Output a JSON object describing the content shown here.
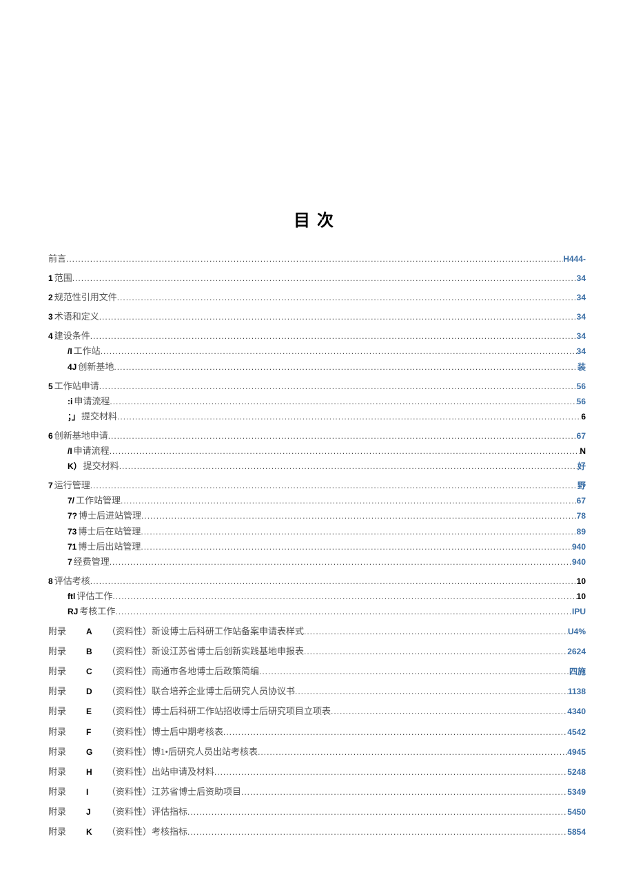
{
  "title": "目次",
  "entries": [
    {
      "level": 0,
      "num": "",
      "label": "前言",
      "page": "H444-",
      "pageClass": "link",
      "numBold": false
    },
    {
      "level": 0,
      "num": "1",
      "label": "范围",
      "page": "34",
      "pageClass": "link",
      "gap": true
    },
    {
      "level": 0,
      "num": "2",
      "label": "规范性引用文件",
      "page": "34",
      "pageClass": "link",
      "gap": true
    },
    {
      "level": 0,
      "num": "3",
      "label": "术语和定义",
      "page": "34",
      "pageClass": "link",
      "gap": true
    },
    {
      "level": 0,
      "num": "4",
      "label": "建设条件",
      "page": "34",
      "pageClass": "link",
      "gap": true
    },
    {
      "level": 1,
      "num": "/I",
      "label": "工作站",
      "page": "34",
      "pageClass": "link"
    },
    {
      "level": 1,
      "num": "4J",
      "label": "创新基地",
      "page": "装",
      "pageClass": "link"
    },
    {
      "level": 0,
      "num": "5",
      "label": "工作站申请",
      "page": "56",
      "pageClass": "link",
      "gap": true
    },
    {
      "level": 1,
      "num": ":i",
      "label": "申请流程",
      "page": "56",
      "pageClass": "link"
    },
    {
      "level": 1,
      "num": "；」",
      "label": "提交材料",
      "page": "6",
      "pageClass": "black"
    },
    {
      "level": 0,
      "num": "6",
      "label": "创新基地申请",
      "page": "67",
      "pageClass": "link",
      "gap": true
    },
    {
      "level": 1,
      "num": "/I",
      "label": "申请流程",
      "page": "N",
      "pageClass": "black"
    },
    {
      "level": 1,
      "num": "K）",
      "label": "提交材料",
      "page": "好",
      "pageClass": "link"
    },
    {
      "level": 0,
      "num": "7",
      "label": "运行管理",
      "page": "野",
      "pageClass": "link",
      "gap": true
    },
    {
      "level": 1,
      "num": "7/",
      "label": "工作站管理",
      "page": "67",
      "pageClass": "link"
    },
    {
      "level": 1,
      "num": "7?",
      "label": "博士后进站管理",
      "page": "78",
      "pageClass": "link"
    },
    {
      "level": 1,
      "num": "73",
      "label": "博士后在站管理",
      "page": "89",
      "pageClass": "link"
    },
    {
      "level": 1,
      "num": "71",
      "label": "博士后出站管理",
      "page": "940",
      "pageClass": "link"
    },
    {
      "level": 1,
      "num": "7",
      "label": "经费管理",
      "page": "940",
      "pageClass": "link"
    },
    {
      "level": 0,
      "num": "8",
      "label": "评估考核",
      "page": "10",
      "pageClass": "black",
      "gap": true
    },
    {
      "level": 1,
      "num": "ftl",
      "label": "评估工作",
      "page": "10",
      "pageClass": "black"
    },
    {
      "level": 1,
      "num": "RJ",
      "label": "考核工作",
      "page": "IPU",
      "pageClass": "link"
    }
  ],
  "appendices": [
    {
      "letter": "A",
      "text": "（资料性）新设博士后科研工作站备案申请表样式",
      "page": "U4%",
      "pageClass": "link"
    },
    {
      "letter": "B",
      "text": "（资料性）新设江苏省博士后创新实践基地申报表",
      "page": "2624",
      "pageClass": "link"
    },
    {
      "letter": "C",
      "text": "（资料性）南通市各地博士后政策简编",
      "page": "四施",
      "pageClass": "link"
    },
    {
      "letter": "D",
      "text": "（资料性）联合培养企业博士后研究人员协议书",
      "page": "1138",
      "pageClass": "link"
    },
    {
      "letter": "E",
      "text": "（资料性）博士后科研工作站招收博士后研究项目立项表",
      "page": "4340",
      "pageClass": "link"
    },
    {
      "letter": "F",
      "text": "（资料性）博士后中期考核表",
      "page": "4542",
      "pageClass": "link"
    },
    {
      "letter": "G",
      "text": "（资料性）博1•后研究人员出站考核表",
      "page": "4945",
      "pageClass": "link"
    },
    {
      "letter": "H",
      "text": "（资料性）出站申请及材料",
      "page": "5248",
      "pageClass": "link"
    },
    {
      "letter": "I",
      "text": "（资料性）江苏省博士后资助项目",
      "page": "5349",
      "pageClass": "link"
    },
    {
      "letter": "J",
      "text": "（资料性）评估指标",
      "page": "5450",
      "pageClass": "link"
    },
    {
      "letter": "K",
      "text": "（资料性）考核指标",
      "page": "5854",
      "pageClass": "link"
    }
  ],
  "apLabel": "附录"
}
